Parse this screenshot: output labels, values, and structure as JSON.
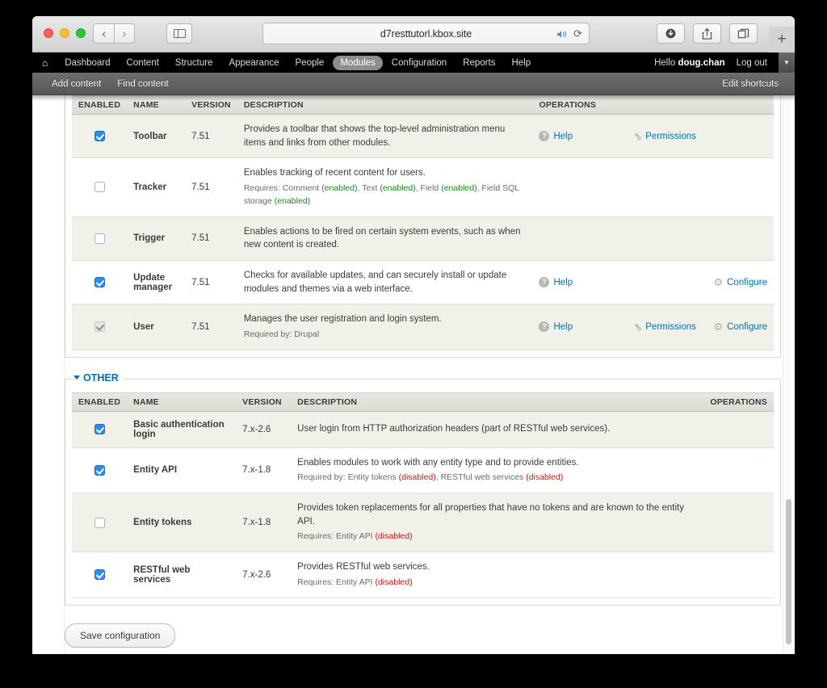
{
  "browser": {
    "url": "d7resttutorl.kbox.site",
    "traffic_lights": [
      "close",
      "minimize",
      "zoom"
    ],
    "back_label": "‹",
    "forward_label": "›",
    "sidebar_icon": "sidebar-icon",
    "speaker_icon": "speaker-icon",
    "reload_icon": "⟳",
    "download_icon": "download-icon",
    "share_icon": "share-icon",
    "tabs_icon": "tabs-icon",
    "new_tab_label": "+"
  },
  "admin_toolbar": {
    "home_icon": "⌂",
    "items": [
      {
        "label": "Dashboard",
        "active": false
      },
      {
        "label": "Content",
        "active": false
      },
      {
        "label": "Structure",
        "active": false
      },
      {
        "label": "Appearance",
        "active": false
      },
      {
        "label": "People",
        "active": false
      },
      {
        "label": "Modules",
        "active": true
      },
      {
        "label": "Configuration",
        "active": false
      },
      {
        "label": "Reports",
        "active": false
      },
      {
        "label": "Help",
        "active": false
      }
    ],
    "greeting_prefix": "Hello ",
    "username": "doug.chan",
    "logout_label": "Log out",
    "caret_label": "▼"
  },
  "shortcut_bar": {
    "links": [
      "Add content",
      "Find content"
    ],
    "edit_label": "Edit shortcuts"
  },
  "table_headers": {
    "enabled": "ENABLED",
    "name": "NAME",
    "version": "VERSION",
    "description": "DESCRIPTION",
    "operations": "OPERATIONS"
  },
  "operations_labels": {
    "help": "Help",
    "permissions": "Permissions",
    "configure": "Configure"
  },
  "core_table": {
    "rows": [
      {
        "checkbox": "on",
        "name": "Toolbar",
        "version": "7.51",
        "desc": "Provides a toolbar that shows the top-level administration menu items and links from other modules.",
        "sub": [],
        "ops": {
          "help": true,
          "permissions": true,
          "configure": false
        }
      },
      {
        "checkbox": "off",
        "name": "Tracker",
        "version": "7.51",
        "desc": "Enables tracking of recent content for users.",
        "sub": [
          {
            "prefix": "Requires: ",
            "parts": [
              {
                "text": "Comment ",
                "state": ""
              },
              {
                "text": "(enabled)",
                "state": "enabled"
              },
              {
                "text": ", Text ",
                "state": ""
              },
              {
                "text": "(enabled)",
                "state": "enabled"
              },
              {
                "text": ", Field ",
                "state": ""
              },
              {
                "text": "(enabled)",
                "state": "enabled"
              },
              {
                "text": ", Field SQL storage ",
                "state": ""
              },
              {
                "text": "(enabled)",
                "state": "enabled"
              }
            ]
          }
        ],
        "ops": {
          "help": false,
          "permissions": false,
          "configure": false
        }
      },
      {
        "checkbox": "off",
        "name": "Trigger",
        "version": "7.51",
        "desc": "Enables actions to be fired on certain system events, such as when new content is created.",
        "sub": [],
        "ops": {
          "help": false,
          "permissions": false,
          "configure": false
        }
      },
      {
        "checkbox": "on",
        "name": "Update manager",
        "version": "7.51",
        "desc": "Checks for available updates, and can securely install or update modules and themes via a web interface.",
        "sub": [],
        "ops": {
          "help": true,
          "permissions": false,
          "configure": true
        }
      },
      {
        "checkbox": "disabled",
        "name": "User",
        "version": "7.51",
        "desc": "Manages the user registration and login system.",
        "sub": [
          {
            "prefix": "Required by: ",
            "parts": [
              {
                "text": "Drupal",
                "state": ""
              }
            ]
          }
        ],
        "ops": {
          "help": true,
          "permissions": true,
          "configure": true
        }
      }
    ]
  },
  "other_section": {
    "legend": "OTHER",
    "rows": [
      {
        "checkbox": "on",
        "name": "Basic authentication login",
        "version": "7.x-2.6",
        "desc": "User login from HTTP authorization headers (part of RESTful web services).",
        "sub": []
      },
      {
        "checkbox": "on",
        "name": "Entity API",
        "version": "7.x-1.8",
        "desc": "Enables modules to work with any entity type and to provide entities.",
        "sub": [
          {
            "prefix": "Required by: ",
            "parts": [
              {
                "text": "Entity tokens ",
                "state": ""
              },
              {
                "text": "(disabled)",
                "state": "disabled"
              },
              {
                "text": ", RESTful web services ",
                "state": ""
              },
              {
                "text": "(disabled)",
                "state": "disabled"
              }
            ]
          }
        ]
      },
      {
        "checkbox": "off",
        "name": "Entity tokens",
        "version": "7.x-1.8",
        "desc": "Provides token replacements for all properties that have no tokens and are known to the entity API.",
        "sub": [
          {
            "prefix": "Requires: ",
            "parts": [
              {
                "text": "Entity API ",
                "state": ""
              },
              {
                "text": "(disabled)",
                "state": "disabled"
              }
            ]
          }
        ]
      },
      {
        "checkbox": "on",
        "name": "RESTful web services",
        "version": "7.x-2.6",
        "desc": "Provides RESTful web services.",
        "sub": [
          {
            "prefix": "Requires: ",
            "parts": [
              {
                "text": "Entity API ",
                "state": ""
              },
              {
                "text": "(disabled)",
                "state": "disabled"
              }
            ]
          }
        ]
      }
    ]
  },
  "footer": {
    "save_label": "Save configuration"
  },
  "colors": {
    "link": "#0071b3",
    "enabled_green": "#1a8a1a",
    "disabled_red": "#c81616",
    "checkbox_blue": "#2d8cf0",
    "row_odd": "#f1f1e9",
    "row_even": "#ffffff",
    "toolbar_black": "#000000"
  }
}
